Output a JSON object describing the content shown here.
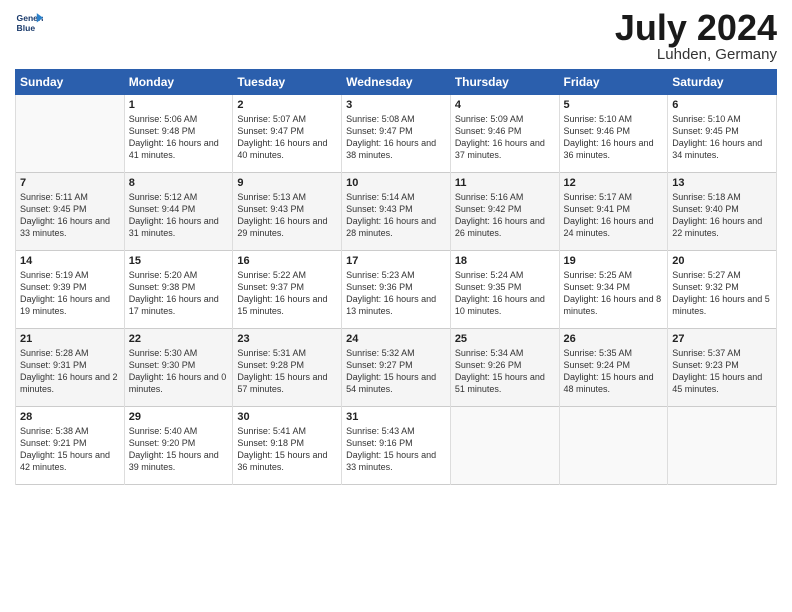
{
  "logo": {
    "line1": "General",
    "line2": "Blue"
  },
  "title": "July 2024",
  "location": "Luhden, Germany",
  "weekdays": [
    "Sunday",
    "Monday",
    "Tuesday",
    "Wednesday",
    "Thursday",
    "Friday",
    "Saturday"
  ],
  "weeks": [
    [
      {
        "day": "",
        "sunrise": "",
        "sunset": "",
        "daylight": ""
      },
      {
        "day": "1",
        "sunrise": "Sunrise: 5:06 AM",
        "sunset": "Sunset: 9:48 PM",
        "daylight": "Daylight: 16 hours and 41 minutes."
      },
      {
        "day": "2",
        "sunrise": "Sunrise: 5:07 AM",
        "sunset": "Sunset: 9:47 PM",
        "daylight": "Daylight: 16 hours and 40 minutes."
      },
      {
        "day": "3",
        "sunrise": "Sunrise: 5:08 AM",
        "sunset": "Sunset: 9:47 PM",
        "daylight": "Daylight: 16 hours and 38 minutes."
      },
      {
        "day": "4",
        "sunrise": "Sunrise: 5:09 AM",
        "sunset": "Sunset: 9:46 PM",
        "daylight": "Daylight: 16 hours and 37 minutes."
      },
      {
        "day": "5",
        "sunrise": "Sunrise: 5:10 AM",
        "sunset": "Sunset: 9:46 PM",
        "daylight": "Daylight: 16 hours and 36 minutes."
      },
      {
        "day": "6",
        "sunrise": "Sunrise: 5:10 AM",
        "sunset": "Sunset: 9:45 PM",
        "daylight": "Daylight: 16 hours and 34 minutes."
      }
    ],
    [
      {
        "day": "7",
        "sunrise": "Sunrise: 5:11 AM",
        "sunset": "Sunset: 9:45 PM",
        "daylight": "Daylight: 16 hours and 33 minutes."
      },
      {
        "day": "8",
        "sunrise": "Sunrise: 5:12 AM",
        "sunset": "Sunset: 9:44 PM",
        "daylight": "Daylight: 16 hours and 31 minutes."
      },
      {
        "day": "9",
        "sunrise": "Sunrise: 5:13 AM",
        "sunset": "Sunset: 9:43 PM",
        "daylight": "Daylight: 16 hours and 29 minutes."
      },
      {
        "day": "10",
        "sunrise": "Sunrise: 5:14 AM",
        "sunset": "Sunset: 9:43 PM",
        "daylight": "Daylight: 16 hours and 28 minutes."
      },
      {
        "day": "11",
        "sunrise": "Sunrise: 5:16 AM",
        "sunset": "Sunset: 9:42 PM",
        "daylight": "Daylight: 16 hours and 26 minutes."
      },
      {
        "day": "12",
        "sunrise": "Sunrise: 5:17 AM",
        "sunset": "Sunset: 9:41 PM",
        "daylight": "Daylight: 16 hours and 24 minutes."
      },
      {
        "day": "13",
        "sunrise": "Sunrise: 5:18 AM",
        "sunset": "Sunset: 9:40 PM",
        "daylight": "Daylight: 16 hours and 22 minutes."
      }
    ],
    [
      {
        "day": "14",
        "sunrise": "Sunrise: 5:19 AM",
        "sunset": "Sunset: 9:39 PM",
        "daylight": "Daylight: 16 hours and 19 minutes."
      },
      {
        "day": "15",
        "sunrise": "Sunrise: 5:20 AM",
        "sunset": "Sunset: 9:38 PM",
        "daylight": "Daylight: 16 hours and 17 minutes."
      },
      {
        "day": "16",
        "sunrise": "Sunrise: 5:22 AM",
        "sunset": "Sunset: 9:37 PM",
        "daylight": "Daylight: 16 hours and 15 minutes."
      },
      {
        "day": "17",
        "sunrise": "Sunrise: 5:23 AM",
        "sunset": "Sunset: 9:36 PM",
        "daylight": "Daylight: 16 hours and 13 minutes."
      },
      {
        "day": "18",
        "sunrise": "Sunrise: 5:24 AM",
        "sunset": "Sunset: 9:35 PM",
        "daylight": "Daylight: 16 hours and 10 minutes."
      },
      {
        "day": "19",
        "sunrise": "Sunrise: 5:25 AM",
        "sunset": "Sunset: 9:34 PM",
        "daylight": "Daylight: 16 hours and 8 minutes."
      },
      {
        "day": "20",
        "sunrise": "Sunrise: 5:27 AM",
        "sunset": "Sunset: 9:32 PM",
        "daylight": "Daylight: 16 hours and 5 minutes."
      }
    ],
    [
      {
        "day": "21",
        "sunrise": "Sunrise: 5:28 AM",
        "sunset": "Sunset: 9:31 PM",
        "daylight": "Daylight: 16 hours and 2 minutes."
      },
      {
        "day": "22",
        "sunrise": "Sunrise: 5:30 AM",
        "sunset": "Sunset: 9:30 PM",
        "daylight": "Daylight: 16 hours and 0 minutes."
      },
      {
        "day": "23",
        "sunrise": "Sunrise: 5:31 AM",
        "sunset": "Sunset: 9:28 PM",
        "daylight": "Daylight: 15 hours and 57 minutes."
      },
      {
        "day": "24",
        "sunrise": "Sunrise: 5:32 AM",
        "sunset": "Sunset: 9:27 PM",
        "daylight": "Daylight: 15 hours and 54 minutes."
      },
      {
        "day": "25",
        "sunrise": "Sunrise: 5:34 AM",
        "sunset": "Sunset: 9:26 PM",
        "daylight": "Daylight: 15 hours and 51 minutes."
      },
      {
        "day": "26",
        "sunrise": "Sunrise: 5:35 AM",
        "sunset": "Sunset: 9:24 PM",
        "daylight": "Daylight: 15 hours and 48 minutes."
      },
      {
        "day": "27",
        "sunrise": "Sunrise: 5:37 AM",
        "sunset": "Sunset: 9:23 PM",
        "daylight": "Daylight: 15 hours and 45 minutes."
      }
    ],
    [
      {
        "day": "28",
        "sunrise": "Sunrise: 5:38 AM",
        "sunset": "Sunset: 9:21 PM",
        "daylight": "Daylight: 15 hours and 42 minutes."
      },
      {
        "day": "29",
        "sunrise": "Sunrise: 5:40 AM",
        "sunset": "Sunset: 9:20 PM",
        "daylight": "Daylight: 15 hours and 39 minutes."
      },
      {
        "day": "30",
        "sunrise": "Sunrise: 5:41 AM",
        "sunset": "Sunset: 9:18 PM",
        "daylight": "Daylight: 15 hours and 36 minutes."
      },
      {
        "day": "31",
        "sunrise": "Sunrise: 5:43 AM",
        "sunset": "Sunset: 9:16 PM",
        "daylight": "Daylight: 15 hours and 33 minutes."
      },
      {
        "day": "",
        "sunrise": "",
        "sunset": "",
        "daylight": ""
      },
      {
        "day": "",
        "sunrise": "",
        "sunset": "",
        "daylight": ""
      },
      {
        "day": "",
        "sunrise": "",
        "sunset": "",
        "daylight": ""
      }
    ]
  ]
}
